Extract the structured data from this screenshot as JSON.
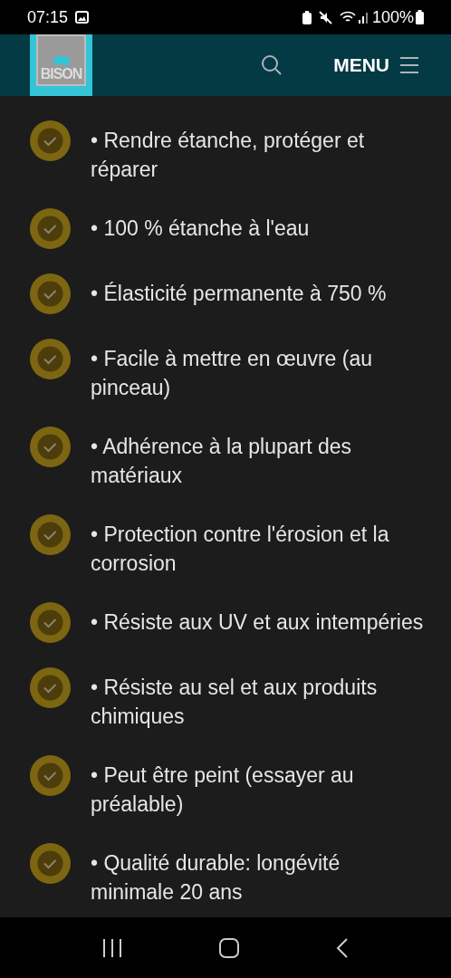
{
  "status_bar": {
    "time": "07:15",
    "battery": "100%"
  },
  "header": {
    "logo": "BISON",
    "menu": "MENU"
  },
  "features": [
    "• Rendre étanche, protéger et réparer",
    "• 100 % étanche à l'eau",
    "• Élasticité permanente à 750 %",
    "• Facile à mettre en œuvre (au pinceau)",
    "• Adhérence à la plupart des matériaux",
    "• Protection contre l'érosion et la corrosion",
    "• Résiste aux UV et aux intempéries",
    "• Résiste au sel et aux produits chimiques",
    "• Peut être peint (essayer au préalable)",
    "• Qualité durable: longévité minimale 20 ans"
  ]
}
